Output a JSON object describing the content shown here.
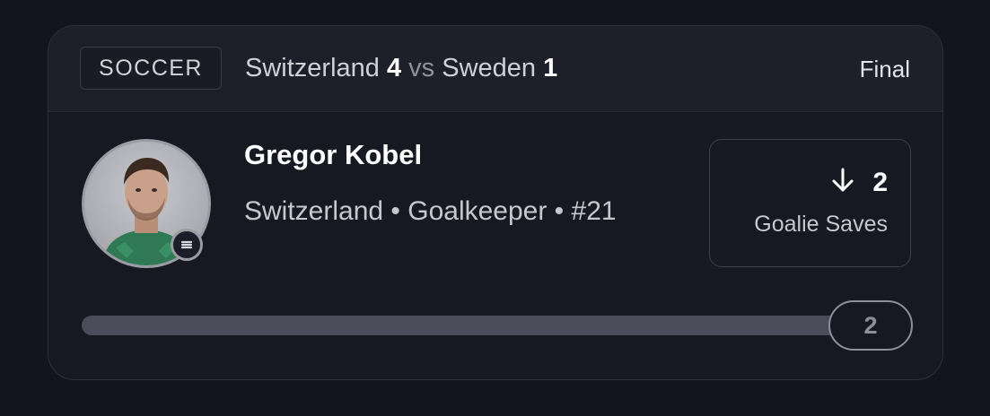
{
  "header": {
    "sport": "SOCCER",
    "home_team": "Switzerland",
    "home_score": "4",
    "vs": "vs",
    "away_team": "Sweden",
    "away_score": "1",
    "status": "Final"
  },
  "player": {
    "name": "Gregor Kobel",
    "meta": "Switzerland • Goalkeeper • #21",
    "avatar_icon": "player-headshot",
    "badge_icon": "menu-circle-icon"
  },
  "stat": {
    "direction_icon": "arrow-down-icon",
    "value": "2",
    "label": "Goalie Saves"
  },
  "progress": {
    "current": 2,
    "target": 2,
    "target_label": "2",
    "fraction": 1.0
  },
  "colors": {
    "background": "#13141e",
    "card": "#171822",
    "header": "#1e1f2a",
    "muted_text": "#c6c7cf"
  }
}
